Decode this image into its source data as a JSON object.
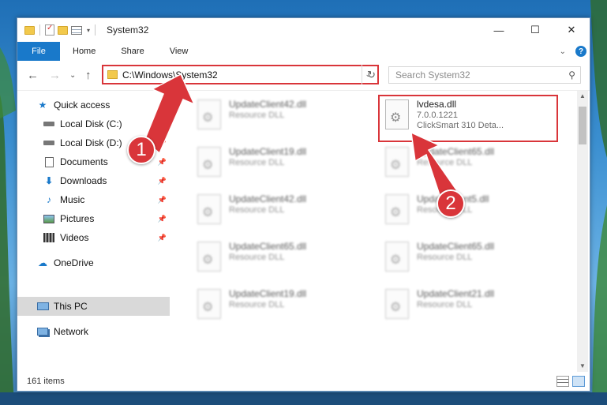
{
  "window": {
    "title": "System32",
    "controls": {
      "minimize": "—",
      "maximize": "☐",
      "close": "✕"
    }
  },
  "ribbon": {
    "tabs": [
      "File",
      "Home",
      "Share",
      "View"
    ],
    "help": "?",
    "collapse": "⌄"
  },
  "nav": {
    "back": "←",
    "forward": "→",
    "recent": "⌄",
    "up": "↑",
    "address": "C:\\Windows\\System32",
    "refresh": "↻",
    "search_placeholder": "Search System32"
  },
  "sidebar": {
    "items": [
      {
        "label": "Quick access",
        "icon": "star-icon"
      },
      {
        "label": "Local Disk (C:)",
        "icon": "drive-icon"
      },
      {
        "label": "Local Disk (D:)",
        "icon": "drive-icon"
      },
      {
        "label": "Documents",
        "icon": "documents-icon"
      },
      {
        "label": "Downloads",
        "icon": "download-icon"
      },
      {
        "label": "Music",
        "icon": "music-icon"
      },
      {
        "label": "Pictures",
        "icon": "pictures-icon"
      },
      {
        "label": "Videos",
        "icon": "videos-icon"
      },
      {
        "label": "OneDrive",
        "icon": "cloud-icon"
      },
      {
        "label": "This PC",
        "icon": "computer-icon"
      },
      {
        "label": "Network",
        "icon": "network-icon"
      }
    ]
  },
  "files": [
    {
      "name": "UpdateClient42.dll",
      "sub": "Resource DLL"
    },
    {
      "name": "lvdesa.dll",
      "version": "7.0.0.1221",
      "description": "ClickSmart 310 Deta..."
    },
    {
      "name": "UpdateClient19.dll",
      "sub": "Resource DLL"
    },
    {
      "name": "UpdateClient65.dll",
      "sub": "Resource DLL"
    },
    {
      "name": "UpdateClient42.dll",
      "sub": "Resource DLL"
    },
    {
      "name": "UpdateClient5.dll",
      "sub": "Resource DLL"
    },
    {
      "name": "UpdateClient65.dll",
      "sub": "Resource DLL"
    },
    {
      "name": "UpdateClient65.dll",
      "sub": "Resource DLL"
    },
    {
      "name": "UpdateClient19.dll",
      "sub": "Resource DLL"
    },
    {
      "name": "UpdateClient21.dll",
      "sub": "Resource DLL"
    }
  ],
  "status": {
    "items": "161 items"
  },
  "annotations": {
    "step1": "1",
    "step2": "2"
  },
  "colors": {
    "accent": "#1979ca",
    "highlight": "#d9353a",
    "selected": "#d9d9d9"
  }
}
